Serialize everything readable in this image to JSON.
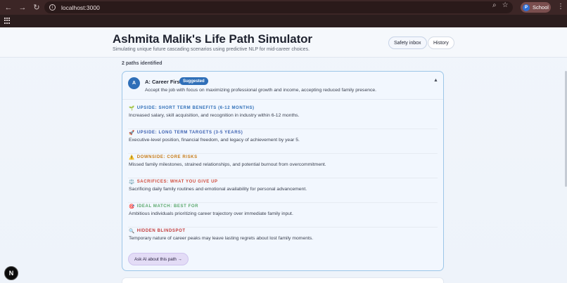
{
  "browser": {
    "url": "localhost:3000",
    "profile_initial": "P",
    "profile_label": "School"
  },
  "header": {
    "title": "Ashmita Malik's Life Path Simulator",
    "subtitle": "Simulating unique future cascading scenarios using predictive NLP for mid-career choices.",
    "inbox_label": "Safety inbox",
    "history_label": "History"
  },
  "paths_count": "2 paths identified",
  "path": {
    "avatar": "A",
    "title": "A: Career First",
    "badge": "Suggested",
    "description": "Accept the job with focus on maximizing professional growth and income, accepting reduced family presence.",
    "sections": [
      {
        "icon": "🌱",
        "heading": "UPSIDE: SHORT TERM BENEFITS (6-12 MONTHS)",
        "body": "Increased salary, skill acquisition, and recognition in industry within 6-12 months.",
        "color": "#2f6fb8"
      },
      {
        "icon": "🚀",
        "heading": "UPSIDE: LONG TERM TARGETS (3-5 YEARS)",
        "body": "Executive-level position, financial freedom, and legacy of achievement by year 5.",
        "color": "#3a5fb0"
      },
      {
        "icon": "⚠️",
        "heading": "DOWNSIDE: CORE RISKS",
        "body": "Missed family milestones, strained relationships, and potential burnout from overcommitment.",
        "color": "#c77a14"
      },
      {
        "icon": "⚖️",
        "heading": "SACRIFICES: WHAT YOU GIVE UP",
        "body": "Sacrificing daily family routines and emotional availability for personal advancement.",
        "color": "#d04a3a"
      },
      {
        "icon": "🎯",
        "heading": "IDEAL MATCH: BEST FOR",
        "body": "Ambitious individuals prioritizing career trajectory over immediate family input.",
        "color": "#5aa86c"
      },
      {
        "icon": "🔍",
        "heading": "HIDDEN BLINDSPOT",
        "body": "Temporary nature of career peaks may leave lasting regrets about lost family moments.",
        "color": "#c23a3a"
      }
    ],
    "ask_label": "Ask AI about this path →"
  },
  "next_logo": "N"
}
